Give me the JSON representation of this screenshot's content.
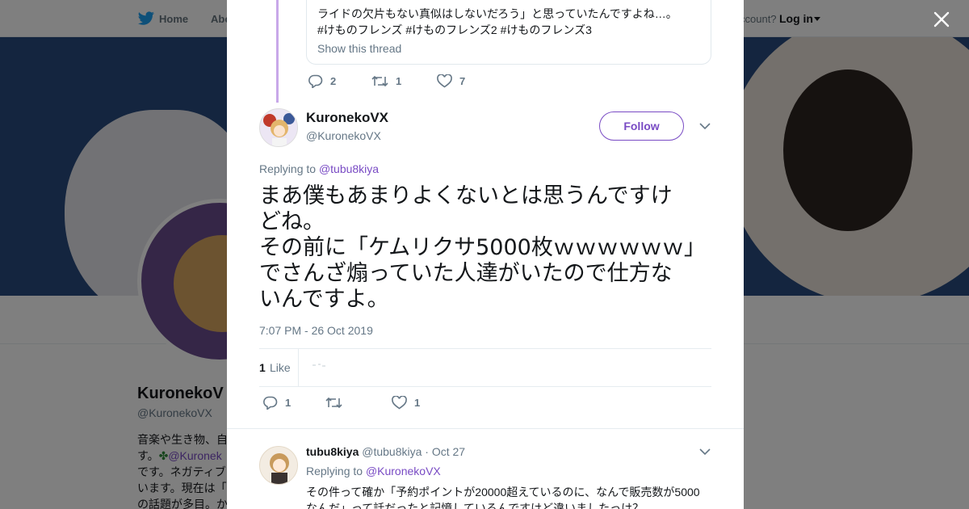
{
  "nav": {
    "home": "Home",
    "about": "Abo",
    "account_prompt": "ccount?",
    "login": "Log in"
  },
  "profile_bg": {
    "name": "KuronekoV",
    "handle": "@KuronekoVX",
    "bio_lines": [
      "音楽や生き物、自",
      "す。",
      "@Kuronek",
      "です。ネガティブ",
      "います。現在は「",
      "の話題が多目。か"
    ],
    "bio_clover": "✤"
  },
  "previous_tweet": {
    "text_line1": "ライドの欠片もない真似はしないだろう」と思っていたんですよね…。",
    "text_line2": "#けものフレンズ #けものフレンズ2 #けものフレンズ3",
    "show_thread": "Show this thread",
    "replies": "2",
    "retweets": "1",
    "likes": "7"
  },
  "main_tweet": {
    "author_name": "KuronekoVX",
    "author_handle": "@KuronekoVX",
    "follow_label": "Follow",
    "replying_prefix": "Replying to",
    "replying_to": "@tubu8kiya",
    "text_lines": [
      "まあ僕もあまりよくないとは思うんですけ",
      "どね。",
      "その前に「ケムリクサ5000枚ｗｗｗｗｗｗ」",
      "でさんざ煽っていた人達がいたので仕方な",
      "いんですよ。"
    ],
    "timestamp": "7:07 PM - 26 Oct 2019",
    "like_count": "1",
    "like_label": "Like",
    "replies": "1",
    "retweets": "",
    "likes": "1"
  },
  "reply_tweet": {
    "author_name": "tubu8kiya",
    "author_handle": "@tubu8kiya",
    "date": "· Oct 27",
    "replying_prefix": "Replying to",
    "replying_to": "@KuronekoVX",
    "text_lines": [
      "その件って確か「予約ポイントが20000超えているのに、なんで販売数が5000",
      "なんだ」って話だったと記憶しているんですけど違いましたっけ？"
    ]
  },
  "colors": {
    "accent": "#794bc4",
    "thread_line": "#c8a8e9",
    "muted": "#657786",
    "text": "#14171a",
    "overlay": "rgba(0,0,0,0.5)"
  },
  "icons": {
    "close": "close-icon",
    "reply": "reply-icon",
    "retweet": "retweet-icon",
    "like": "heart-icon",
    "more": "chevron-down-icon",
    "logo": "twitter-bird-icon"
  }
}
